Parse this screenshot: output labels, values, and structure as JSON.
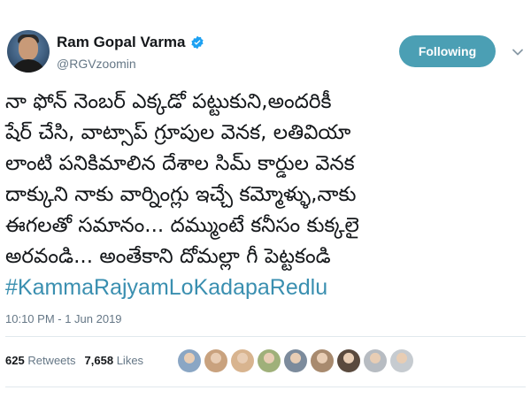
{
  "user": {
    "display_name": "Ram Gopal Varma",
    "handle": "@RGVzoomin",
    "verified": true
  },
  "follow_button": {
    "label": "Following",
    "color": "#4b9fb4"
  },
  "tweet": {
    "lines": [
      "నా  ఫోన్ నెంబర్ ఎక్కడో పట్టుకుని,అందరికీ",
      "షేర్ చేసి, వాట్సాప్ గ్రూపుల వెనక, లతివియా",
      "లాంటి పనికిమాలిన దేశాల సిమ్ కార్డుల వెనక",
      "దాక్కుని నాకు వార్నింగ్లు ఇచ్చే కమ్మోళ్ళు,నాకు",
      "ఈగలతో సమానం... దమ్ముంటే కనీసం కుక్కలై",
      "అరవండి... అంతేకాని దోమల్లా గీ పెట్టకండి"
    ],
    "hashtag": "#KammaRajyamLoKadapaRedlu",
    "hashtag_color": "#3a8fb0",
    "timestamp": "10:10 PM - 1 Jun 2019"
  },
  "stats": {
    "retweets_count": "625",
    "retweets_label": "Retweets",
    "likes_count": "7,658",
    "likes_label": "Likes"
  },
  "liker_avatars": [
    "#8aa6c4",
    "#c9a27e",
    "#d8b48f",
    "#9fb07a",
    "#7c8b9c",
    "#a88a6e",
    "#5a4a3e",
    "#b7bcc2",
    "#c6cbd0"
  ]
}
